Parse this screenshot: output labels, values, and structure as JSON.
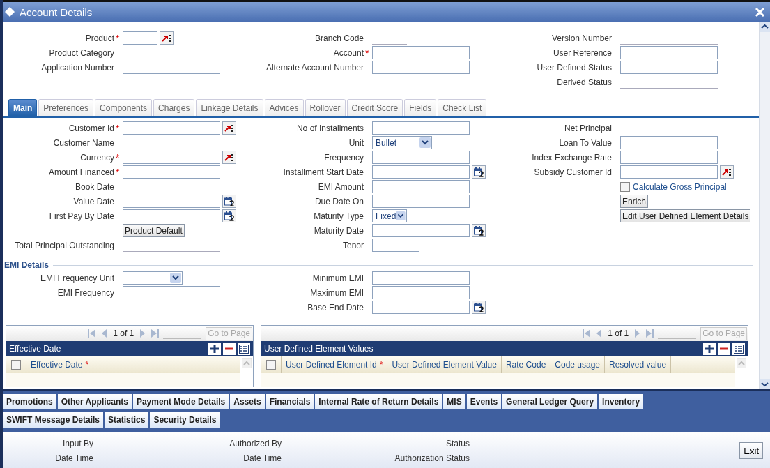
{
  "window": {
    "title": "Account Details"
  },
  "header": {
    "columns": [
      {
        "fields": [
          {
            "kind": "lov",
            "label": "Product",
            "marker": "*"
          },
          {
            "kind": "display",
            "label": "Product Category"
          },
          {
            "kind": "text",
            "label": "Application Number"
          }
        ]
      },
      {
        "fields": [
          {
            "kind": "display",
            "label": "Branch Code"
          },
          {
            "kind": "text",
            "label": "Account",
            "marker": "*"
          },
          {
            "kind": "text",
            "label": "Alternate Account Number"
          }
        ]
      },
      {
        "fields": [
          {
            "kind": "display",
            "label": "Version Number"
          },
          {
            "kind": "text",
            "label": "User Reference"
          },
          {
            "kind": "text",
            "label": "User Defined Status"
          },
          {
            "kind": "display",
            "label": "Derived Status"
          }
        ]
      }
    ]
  },
  "tabs": [
    {
      "label": "Main",
      "selected": true
    },
    {
      "label": "Preferences",
      "selected": false
    },
    {
      "label": "Components",
      "selected": false
    },
    {
      "label": "Charges",
      "selected": false
    },
    {
      "label": "Linkage Details",
      "selected": false
    },
    {
      "label": "Advices",
      "selected": false
    },
    {
      "label": "Rollover",
      "selected": false
    },
    {
      "label": "Credit Score",
      "selected": false
    },
    {
      "label": "Fields",
      "selected": false
    },
    {
      "label": "Check List",
      "selected": false
    }
  ],
  "main": {
    "columns": [
      {
        "fields": [
          {
            "kind": "lov",
            "label": "Customer Id",
            "marker": "*"
          },
          {
            "kind": "label",
            "label": "Customer Name"
          },
          {
            "kind": "lov",
            "label": "Currency",
            "marker": "*"
          },
          {
            "kind": "text",
            "label": "Amount Financed",
            "marker": "*"
          },
          {
            "kind": "display",
            "label": "Book Date"
          },
          {
            "kind": "date",
            "label": "Value Date"
          },
          {
            "kind": "date",
            "label": "First Pay By Date"
          },
          {
            "kind": "button",
            "label": "Product Default"
          },
          {
            "kind": "display",
            "label": "Total Principal Outstanding"
          }
        ]
      },
      {
        "fields": [
          {
            "kind": "text",
            "label": "No of Installments"
          },
          {
            "kind": "select",
            "label": "Unit",
            "value": "Bullet"
          },
          {
            "kind": "text",
            "label": "Frequency"
          },
          {
            "kind": "date",
            "label": "Installment Start Date"
          },
          {
            "kind": "text",
            "label": "EMI Amount"
          },
          {
            "kind": "text",
            "label": "Due Date On"
          },
          {
            "kind": "select",
            "label": "Maturity Type",
            "value": "Fixed"
          },
          {
            "kind": "date",
            "label": "Maturity Date"
          },
          {
            "kind": "text",
            "label": "Tenor"
          }
        ]
      },
      {
        "fields": [
          {
            "kind": "label",
            "label": "Net Principal"
          },
          {
            "kind": "text",
            "label": "Loan To Value"
          },
          {
            "kind": "text",
            "label": "Index Exchange Rate"
          },
          {
            "kind": "lov",
            "label": "Subsidy Customer Id"
          },
          {
            "kind": "checkbox",
            "label": "Calculate Gross Principal",
            "checked": false
          },
          {
            "kind": "button",
            "label": "Enrich"
          },
          {
            "kind": "button",
            "label": "Edit User Defined Element Details"
          }
        ]
      }
    ]
  },
  "emi_details": {
    "title": "EMI Details",
    "columns": [
      {
        "fields": [
          {
            "kind": "select",
            "label": "EMI Frequency Unit"
          },
          {
            "kind": "text",
            "label": "EMI Frequency"
          }
        ]
      },
      {
        "fields": [
          {
            "kind": "text",
            "label": "Minimum EMI"
          },
          {
            "kind": "text",
            "label": "Maximum EMI"
          },
          {
            "kind": "date",
            "label": "Base End Date"
          }
        ]
      }
    ]
  },
  "grids": [
    {
      "pager": "1 of 1",
      "go_to": "Go to Page",
      "title": "Effective Date",
      "select_all": false,
      "columns": [
        {
          "label": "Effective Date",
          "marker": "*"
        }
      ]
    },
    {
      "pager": "1 of 1",
      "go_to": "Go to Page",
      "title": "User Defined Element Values",
      "select_all": false,
      "columns": [
        {
          "label": "User Defined Element Id",
          "marker": "*"
        },
        {
          "label": "User Defined Element Value"
        },
        {
          "label": "Rate Code"
        },
        {
          "label": "Code usage"
        },
        {
          "label": "Resolved value"
        }
      ]
    }
  ],
  "subsystem_tabs": [
    [
      "Promotions",
      "Other Applicants",
      "Payment Mode Details",
      "Assets",
      "Financials",
      "Internal Rate of Return Details",
      "MIS",
      "Events",
      "General Ledger Query",
      "Inventory"
    ],
    [
      "SWIFT Message Details",
      "Statistics",
      "Security Details"
    ]
  ],
  "footer": {
    "columns": [
      [
        "Input By",
        "Date Time"
      ],
      [
        "Authorized By",
        "Date Time"
      ],
      [
        "Status",
        "Authorization Status"
      ]
    ],
    "exit": "Exit"
  }
}
